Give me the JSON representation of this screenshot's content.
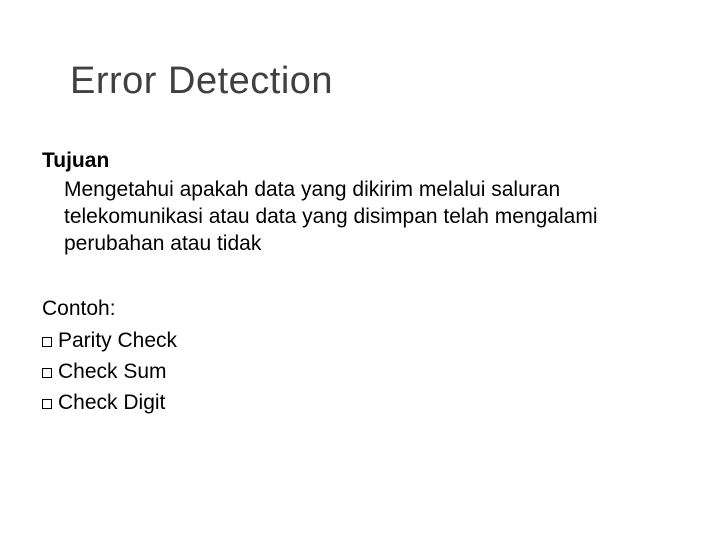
{
  "title": "Error Detection",
  "section1": {
    "heading": "Tujuan",
    "paragraph": "Mengetahui apakah data yang dikirim melalui saluran telekomunikasi atau data yang disimpan telah mengalami perubahan atau tidak"
  },
  "section2": {
    "heading": "Contoh:",
    "items": [
      "Parity Check",
      "Check Sum",
      "Check Digit"
    ]
  }
}
